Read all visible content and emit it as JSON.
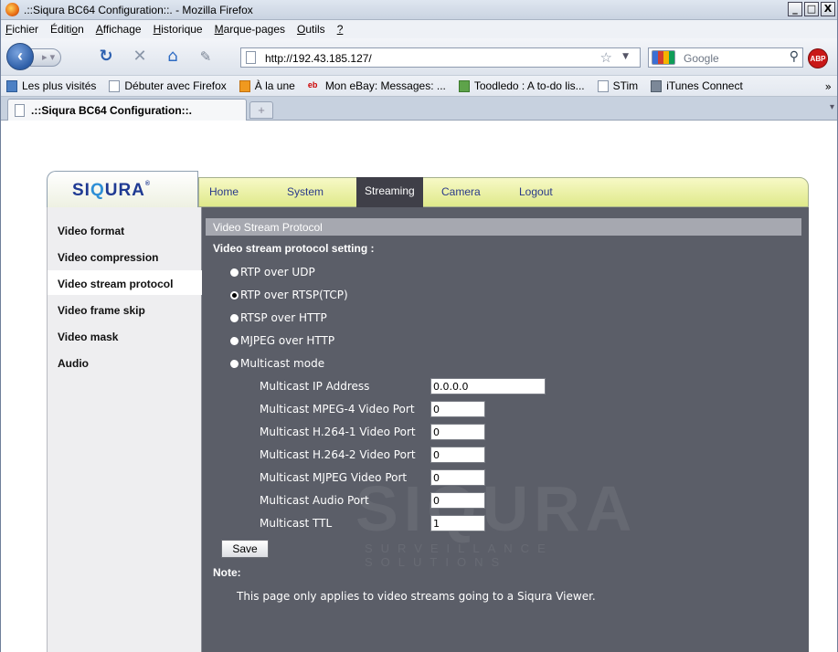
{
  "browser": {
    "window_title": ".::Siqura BC64 Configuration::. - Mozilla Firefox",
    "window_buttons": {
      "minimize": "_",
      "maximize": "□",
      "close": "X"
    },
    "menu": [
      {
        "pre": "",
        "u": "F",
        "post": "ichier"
      },
      {
        "pre": "Éditi",
        "u": "o",
        "post": "n"
      },
      {
        "pre": "",
        "u": "A",
        "post": "ffichage"
      },
      {
        "pre": "",
        "u": "H",
        "post": "istorique"
      },
      {
        "pre": "",
        "u": "M",
        "post": "arque-pages"
      },
      {
        "pre": "",
        "u": "O",
        "post": "utils"
      },
      {
        "pre": "",
        "u": "?",
        "post": ""
      }
    ],
    "url": "http://192.43.185.127/",
    "search_placeholder": "Google",
    "abp_label": "ABP",
    "bookmarks": [
      {
        "label": "Les plus visités",
        "icon": "most-visited-icon"
      },
      {
        "label": "Débuter avec Firefox",
        "icon": "page-icon"
      },
      {
        "label": "À la une",
        "icon": "rss-icon"
      },
      {
        "label": "Mon eBay: Messages: ...",
        "icon": "ebay-icon"
      },
      {
        "label": "Toodledo : A to-do lis...",
        "icon": "toodledo-icon"
      },
      {
        "label": "STim",
        "icon": "page-icon"
      },
      {
        "label": "iTunes Connect",
        "icon": "itunes-icon"
      }
    ],
    "bookmarks_more": "»",
    "tab_title": ".::Siqura BC64 Configuration::.",
    "newtab_label": "+"
  },
  "app": {
    "logo": {
      "part1": "SI",
      "part2": "Q",
      "part3": "URA",
      "sup": "®"
    },
    "topnav": [
      {
        "label": "Home",
        "active": false
      },
      {
        "label": "System",
        "active": false
      },
      {
        "label": "Streaming",
        "active": true
      },
      {
        "label": "Camera",
        "active": false
      },
      {
        "label": "Logout",
        "active": false
      }
    ],
    "sidebar": [
      {
        "label": "Video format",
        "active": false
      },
      {
        "label": "Video compression",
        "active": false
      },
      {
        "label": "Video stream protocol",
        "active": true
      },
      {
        "label": "Video frame skip",
        "active": false
      },
      {
        "label": "Video mask",
        "active": false
      },
      {
        "label": "Audio",
        "active": false
      }
    ],
    "panel": {
      "heading": "Video Stream Protocol",
      "setting_label": "Video stream protocol setting :",
      "options": [
        {
          "label": "RTP over UDP",
          "checked": false
        },
        {
          "label": "RTP over RTSP(TCP)",
          "checked": true
        },
        {
          "label": "RTSP over HTTP",
          "checked": false
        },
        {
          "label": "MJPEG over HTTP",
          "checked": false
        },
        {
          "label": "Multicast mode",
          "checked": false
        }
      ],
      "multicast_fields": [
        {
          "label": "Multicast IP Address",
          "value": "0.0.0.0"
        },
        {
          "label": "Multicast MPEG-4 Video Port",
          "value": "0"
        },
        {
          "label": "Multicast H.264-1 Video Port",
          "value": "0"
        },
        {
          "label": "Multicast H.264-2 Video Port",
          "value": "0"
        },
        {
          "label": "Multicast MJPEG Video Port",
          "value": "0"
        },
        {
          "label": "Multicast Audio Port",
          "value": "0"
        },
        {
          "label": "Multicast TTL",
          "value": "1"
        }
      ],
      "save_label": "Save",
      "note_label": "Note:",
      "note_text": "This page only applies to video streams going to a Siqura Viewer.",
      "watermark_main": "SIQURA",
      "watermark_sub": "SURVEILLANCE SOLUTIONS"
    }
  }
}
